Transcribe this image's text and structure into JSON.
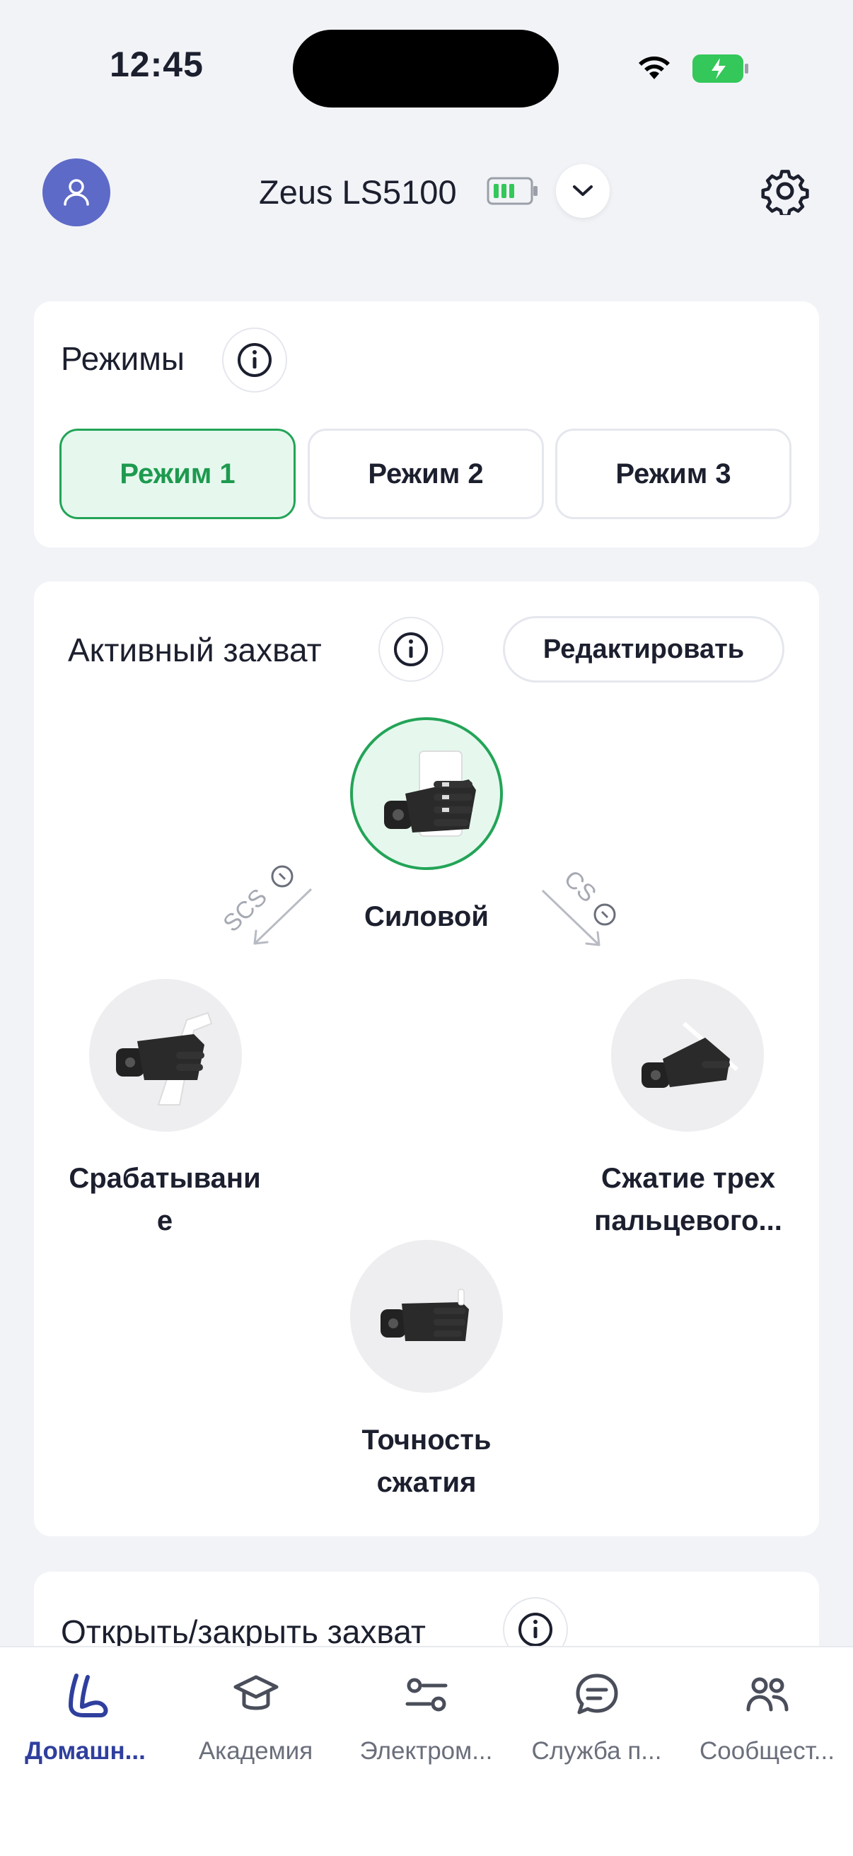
{
  "status_bar": {
    "time": "12:45"
  },
  "header": {
    "device_name": "Zeus LS5100"
  },
  "modes_card": {
    "title": "Режимы",
    "modes": [
      "Режим 1",
      "Режим 2",
      "Режим 3"
    ],
    "active_mode": "Режим 1"
  },
  "grip_card": {
    "title": "Активный захват",
    "edit_label": "Редактировать",
    "grips": [
      {
        "label": "Силовой",
        "active": true
      },
      {
        "label": "Срабатывани\nе",
        "active": false
      },
      {
        "label": "Сжатие трех\nпальцевого...",
        "active": false
      },
      {
        "label": "Точность\nсжатия",
        "active": false
      }
    ],
    "arrow_left_label": "SCS",
    "arrow_right_label": "CS"
  },
  "open_close_card": {
    "title": "Открыть/закрыть захват"
  },
  "bottom_nav": {
    "items": [
      {
        "label": "Домашн...",
        "icon": "arm-icon",
        "active": true
      },
      {
        "label": "Академия",
        "icon": "graduation-cap-icon",
        "active": false
      },
      {
        "label": "Электром...",
        "icon": "sliders-icon",
        "active": false
      },
      {
        "label": "Служба п...",
        "icon": "chat-bubble-icon",
        "active": false
      },
      {
        "label": "Сообщест...",
        "icon": "community-icon",
        "active": false
      }
    ]
  },
  "colors": {
    "accent_green": "#23A457",
    "avatar": "#5E6AC7",
    "nav_active": "#2F3F9E"
  }
}
